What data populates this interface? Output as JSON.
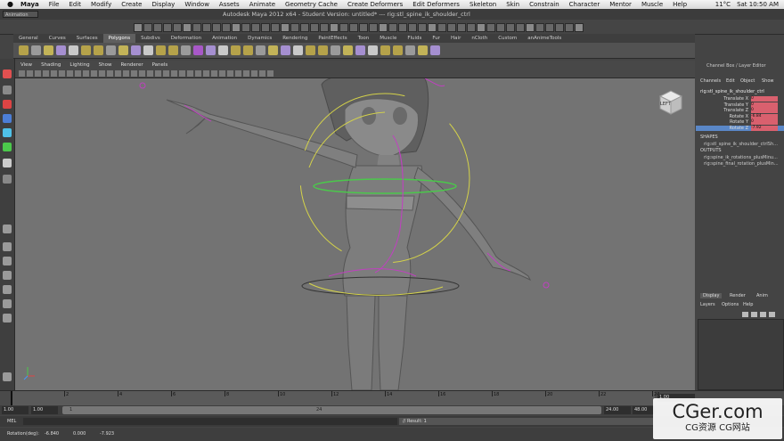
{
  "mac_menubar": {
    "items": [
      "Maya",
      "File",
      "Edit",
      "Modify",
      "Create",
      "Display",
      "Window",
      "Assets",
      "Animate",
      "Geometry Cache",
      "Create Deformers",
      "Edit Deformers",
      "Skeleton",
      "Skin",
      "Constrain",
      "Character",
      "Mentor",
      "Muscle",
      "Help"
    ],
    "clock": "Sat 10:50 AM",
    "temp": "11°C"
  },
  "titlebar": {
    "mode": "Animation",
    "title": "Autodesk Maya 2012 x64 - Student Version: untitled*   ---   rig:stl_spine_ik_shoulder_ctrl"
  },
  "shelf_tabs": [
    "General",
    "Curves",
    "Surfaces",
    "Polygons",
    "Subdivs",
    "Deformation",
    "Animation",
    "Dynamics",
    "Rendering",
    "PaintEffects",
    "Toon",
    "Muscle",
    "Fluids",
    "Fur",
    "Hair",
    "nCloth",
    "Custom",
    "anAnimeTools"
  ],
  "shelf_active_tab": "Polygons",
  "panel_menu": [
    "View",
    "Shading",
    "Lighting",
    "Show",
    "Renderer",
    "Panels"
  ],
  "viewcube_label": "LEFT",
  "channel_box": {
    "title": "Channel Box / Layer Editor",
    "menu": [
      "Channels",
      "Edit",
      "Object",
      "Show"
    ],
    "node": "rig:stl_spine_ik_shoulder_ctrl",
    "attributes": [
      {
        "name": "Translate X",
        "value": "0"
      },
      {
        "name": "Translate Y",
        "value": "0"
      },
      {
        "name": "Translate Z",
        "value": "0"
      },
      {
        "name": "Rotate X",
        "value": "-6.84"
      },
      {
        "name": "Rotate Y",
        "value": "0"
      },
      {
        "name": "Rotate Z",
        "value": "-7.92"
      }
    ],
    "shapes_header": "SHAPES",
    "shapes": [
      "rig:stl_spine_ik_shoulder_ctrlSh..."
    ],
    "outputs_header": "OUTPUTS",
    "outputs": [
      "rig:spine_ik_rotations_plusMinu...",
      "rig:spine_final_rotation_plusMin..."
    ]
  },
  "layer_editor": {
    "tabs": [
      "Display",
      "Render",
      "Anim"
    ],
    "menu": [
      "Layers",
      "Options",
      "Help"
    ]
  },
  "time_slider": {
    "ticks": [
      "2",
      "4",
      "6",
      "8",
      "10",
      "12",
      "14",
      "16",
      "18",
      "20",
      "22",
      "24"
    ],
    "current_frame": "1.00"
  },
  "range_slider": {
    "start": "1.00",
    "inner_start": "1.00",
    "inner_start_label": "1",
    "inner_end_label": "24",
    "end": "24.00",
    "end_total": "48.00"
  },
  "command_line": {
    "label": "MEL",
    "result": "// Result: 1"
  },
  "help_line": {
    "label": "Rotation(deg):",
    "x": "-6.840",
    "y": "0.000",
    "z": "-7.923"
  },
  "watermark": {
    "big": "CGer.com",
    "small": "CG资源  CG网站"
  },
  "colors": {
    "viewport_bg": "#737373",
    "channel_highlight": "#d9606e",
    "selected_attr": "#5a87c7"
  }
}
